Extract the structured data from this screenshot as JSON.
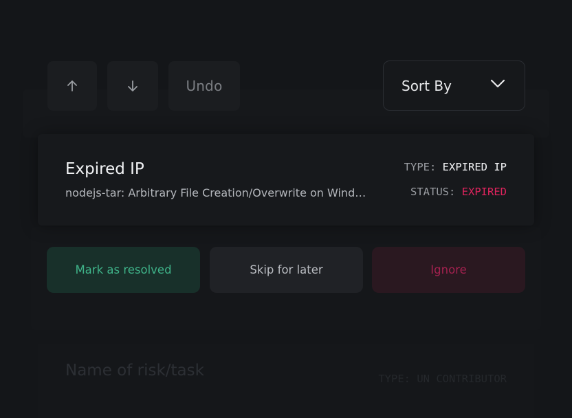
{
  "toolbar": {
    "up_icon": "arrow-up-icon",
    "down_icon": "arrow-down-icon",
    "undo_label": "Undo",
    "sort_label": "Sort By",
    "sort_icon": "chevron-down-icon"
  },
  "current_item": {
    "title": "Expired IP",
    "description": "nodejs-tar: Arbitrary File Creation/Overwrite on Windows via insufficient relative path sanitization",
    "type_key": "TYPE:",
    "type_value": "EXPIRED IP",
    "status_key": "STATUS:",
    "status_value": "EXPIRED"
  },
  "actions": {
    "resolve_label": "Mark as resolved",
    "skip_label": "Skip for later",
    "ignore_label": "Ignore"
  },
  "next_item": {
    "title": "Name of risk/task",
    "type_key": "TYPE:",
    "type_value": "UN CONTRIBUTOR"
  },
  "colors": {
    "background": "#141619",
    "resolve": "#3fb389",
    "ignore": "#e0245e",
    "expired": "#e0245e"
  }
}
